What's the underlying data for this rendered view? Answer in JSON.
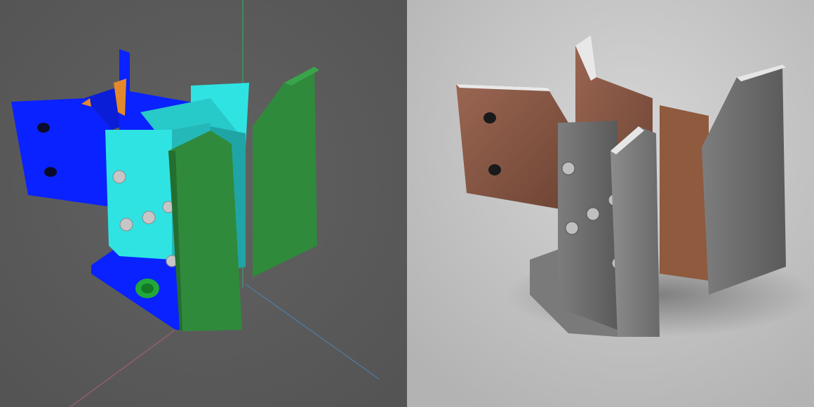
{
  "panels": [
    {
      "id": "viewport-cad",
      "kind": "cad-viewport",
      "colors": {
        "background": "#5b5b5b",
        "blue_part": "#0a22ff",
        "cyan_part": "#2fe3e3",
        "green_part": "#2f8a3b",
        "orange_part": "#e4892b",
        "axis_green": "#2db36b",
        "axis_red": "#b0607a",
        "axis_blue": "#4a86b8"
      }
    },
    {
      "id": "render-photoreal",
      "kind": "photoreal-render",
      "colors": {
        "background": "#bdbdbd",
        "copper": "#8a5a45",
        "steel": "#6f6f6f",
        "steel_light": "#9a9a9a",
        "washer": "#dcd6c8"
      }
    }
  ]
}
